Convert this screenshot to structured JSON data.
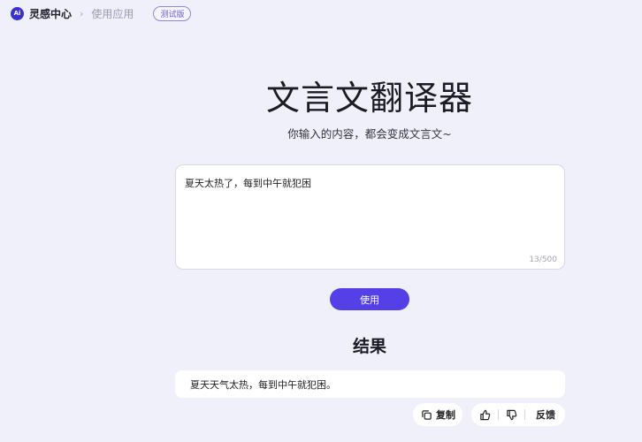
{
  "breadcrumb": {
    "logo_text": "Ai",
    "home": "灵感中心",
    "separator": "›",
    "current": "使用应用",
    "badge": "测试版"
  },
  "header": {
    "title": "文言文翻译器",
    "subtitle": "你输入的内容，都会变成文言文~"
  },
  "input": {
    "value": "夏天太热了，每到中午就犯困",
    "counter": "13/500"
  },
  "actions": {
    "use_label": "使用"
  },
  "result": {
    "heading": "结果",
    "text": "夏天天气太热，每到中午就犯困。",
    "copy_label": "复制",
    "feedback_label": "反馈"
  },
  "colors": {
    "background": "#f0f0fb",
    "accent": "#5540e8",
    "badge": "#6a63c9"
  },
  "icons": [
    "logo-icon",
    "chevron-right-icon",
    "copy-icon",
    "thumbs-up-icon",
    "thumbs-down-icon"
  ]
}
